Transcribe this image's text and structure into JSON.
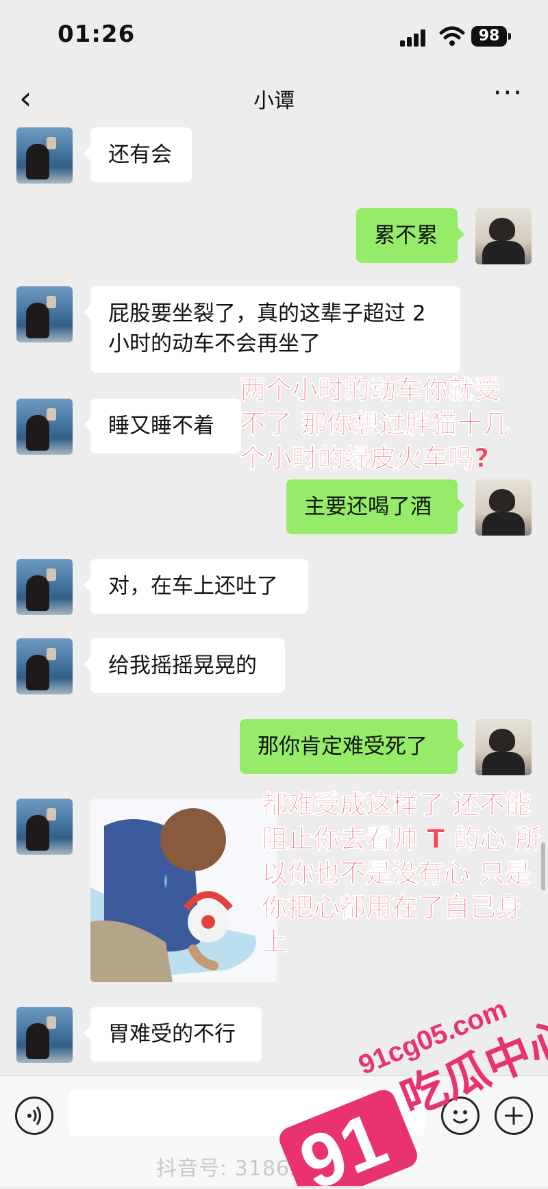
{
  "status": {
    "time": "01:26",
    "battery": "98"
  },
  "nav": {
    "title": "小谭",
    "back_glyph": "‹",
    "more_glyph": "···"
  },
  "messages": [
    {
      "from": "her",
      "text": "还有会"
    },
    {
      "from": "me",
      "text": "累不累"
    },
    {
      "from": "her",
      "text_lines": [
        "屁股要坐裂了，真的这辈子超过 2",
        "小时的动车不会再坐了"
      ]
    },
    {
      "from": "her",
      "text": "睡又睡不着"
    },
    {
      "from": "me",
      "text": "主要还喝了酒"
    },
    {
      "from": "her",
      "text": "对，在车上还吐了"
    },
    {
      "from": "her",
      "text": "给我摇摇晃晃的"
    },
    {
      "from": "me",
      "text": "那你肯定难受死了"
    },
    {
      "from": "her",
      "sticker": "person-crying-over-clown-sticker"
    },
    {
      "from": "her",
      "text": "胃难受的不行"
    }
  ],
  "annotations": {
    "a1": [
      "两个小时的动车你就受",
      "不了 那你想过胖猫十几",
      "个小时的绿皮火车吗?"
    ],
    "a2": [
      "都难受成这样了 还不能",
      "阻止你去看帅 T 的心 所",
      "以你也不是没有心 只是",
      "你把心都用在了自己身",
      "上"
    ]
  },
  "bottom": {
    "voice_icon": "voice-icon",
    "emoji_icon": "emoji-icon",
    "plus_icon": "plus-icon",
    "tiktok_label": "抖音号: 31863 85787"
  },
  "watermark": {
    "number": "91",
    "site": "91cg05.com",
    "label": "吃瓜中心",
    "color": "#e8336e"
  }
}
